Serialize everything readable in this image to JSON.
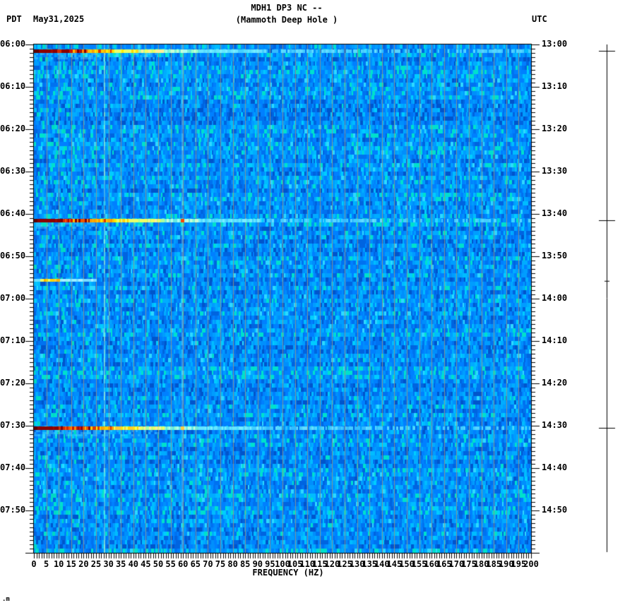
{
  "header": {
    "title_line1": "MDH1 DP3 NC --",
    "title_line2": "(Mammoth Deep Hole )",
    "tz_left": "PDT",
    "date": "May31,2025",
    "tz_right": "UTC"
  },
  "footer_note": ".m",
  "chart_data": {
    "type": "heatmap",
    "subtype": "seismic-spectrogram",
    "title": "MDH1 DP3 NC -- (Mammoth Deep Hole )",
    "station": "MDH1 DP3 NC",
    "station_name": "Mammoth Deep Hole",
    "date": "May31,2025",
    "xlabel": "FREQUENCY (HZ)",
    "x_range_hz": [
      0,
      200
    ],
    "x_label_step_hz": 5,
    "x_minor_tick_hz": 1,
    "time_span_minutes": 120,
    "minor_tick_minutes": 1,
    "label_step_minutes": 10,
    "left_axis": {
      "timezone": "PDT",
      "start": "06:00",
      "end": "08:00",
      "labels": [
        "06:00",
        "06:10",
        "06:20",
        "06:30",
        "06:40",
        "06:50",
        "07:00",
        "07:10",
        "07:20",
        "07:30",
        "07:40",
        "07:50"
      ]
    },
    "right_axis": {
      "timezone": "UTC",
      "start": "13:00",
      "end": "15:00",
      "labels": [
        "13:00",
        "13:10",
        "13:20",
        "13:30",
        "13:40",
        "13:50",
        "14:00",
        "14:10",
        "14:20",
        "14:30",
        "14:40",
        "14:50"
      ]
    },
    "freq_labels": [
      "0",
      "5",
      "10",
      "15",
      "20",
      "25",
      "30",
      "35",
      "40",
      "45",
      "50",
      "55",
      "60",
      "65",
      "70",
      "75",
      "80",
      "85",
      "90",
      "95",
      "100",
      "105",
      "110",
      "115",
      "120",
      "125",
      "130",
      "135",
      "140",
      "145",
      "150",
      "155",
      "160",
      "165",
      "170",
      "175",
      "180",
      "185",
      "190",
      "195",
      "200"
    ],
    "background": {
      "description": "broadband blue noise field",
      "palette": [
        "#0055cc",
        "#0064e0",
        "#0072f0",
        "#0080ff",
        "#008ffc",
        "#009dff",
        "#00acff",
        "#00bcff",
        "#00ccff",
        "#2ed8ff",
        "#00e0cc"
      ]
    },
    "gridlines": {
      "every_hz": 5,
      "color": "rgba(150,148,130,0.85)"
    },
    "persistent_lines": [
      {
        "hz": 28,
        "color_rgb": "180,255,200",
        "strength": 0.6
      },
      {
        "hz": 59.5,
        "color_rgb": "190,255,235",
        "strength": 0.3
      }
    ],
    "events": [
      {
        "time_pdt": "06:01",
        "time_utc": "13:01",
        "start_minute": 1.2,
        "duration_minutes": 0.9,
        "max_freq_hz": 200,
        "intensity": "strong"
      },
      {
        "time_pdt": "06:41",
        "time_utc": "13:41",
        "start_minute": 41.1,
        "duration_minutes": 0.9,
        "max_freq_hz": 200,
        "intensity": "strong",
        "hot_spot_hz": 60,
        "hot_spot_color": "#ff4400"
      },
      {
        "time_pdt": "06:55",
        "time_utc": "13:55",
        "start_minute": 55.3,
        "duration_minutes": 0.7,
        "max_freq_hz": 25,
        "intensity": "weak"
      },
      {
        "time_pdt": "07:30",
        "time_utc": "14:30",
        "start_minute": 90.2,
        "duration_minutes": 0.9,
        "max_freq_hz": 200,
        "intensity": "strong",
        "hot_spot_hz": 60,
        "hot_spot_color": "#ffcc44"
      }
    ],
    "event_marker_bar": {
      "ticks": [
        {
          "minute": 1.5,
          "size": "large"
        },
        {
          "minute": 41.5,
          "size": "large"
        },
        {
          "minute": 55.8,
          "size": "small"
        },
        {
          "minute": 90.5,
          "size": "large"
        }
      ]
    }
  }
}
